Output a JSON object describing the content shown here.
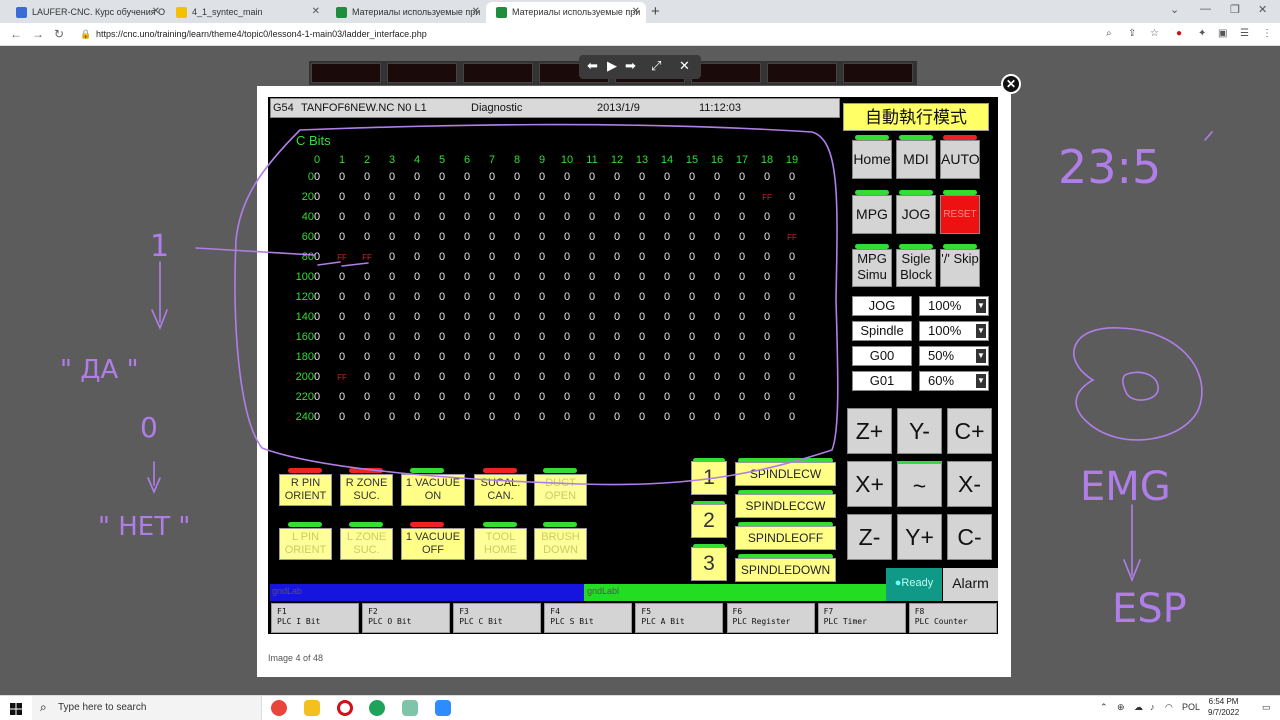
{
  "browser": {
    "tabs": [
      {
        "title": "LAUFER-CNC. Курс обучения О",
        "favicon_color": "#3b6bd6"
      },
      {
        "title": "4_1_syntec_main",
        "favicon_color": "#f2c200"
      },
      {
        "title": "Материалы используемые при",
        "favicon_color": "#1e8e3e"
      },
      {
        "title": "Материалы используемые при",
        "favicon_color": "#1e8e3e"
      }
    ],
    "url": "https://cnc.uno/training/learn/theme4/topic0/lesson4-1-main03/ladder_interface.php"
  },
  "viewer": {
    "counter": "Image 4 of 48"
  },
  "cnc": {
    "status": {
      "coord": "G54",
      "program": "TANFOF6NEW.NC N0 L1",
      "screen": "Diagnostic",
      "date": "2013/1/9",
      "time": "11:12:03"
    },
    "cbits_title": "C Bits",
    "columns": [
      "0",
      "1",
      "2",
      "3",
      "4",
      "5",
      "6",
      "7",
      "8",
      "9",
      "10",
      "11",
      "12",
      "13",
      "14",
      "15",
      "16",
      "17",
      "18",
      "19"
    ],
    "rows": [
      "0",
      "20",
      "40",
      "60",
      "80",
      "100",
      "120",
      "140",
      "160",
      "180",
      "200",
      "220",
      "240"
    ],
    "ff_cells": [
      {
        "row": "20",
        "col": 18
      },
      {
        "row": "60",
        "col": 19
      },
      {
        "row": "80",
        "col": 1
      },
      {
        "row": "80",
        "col": 2
      },
      {
        "row": "200",
        "col": 1
      }
    ],
    "mode_banner": "自動執行模式",
    "mode_buttons": [
      {
        "label": "Home",
        "led": "green"
      },
      {
        "label": "MDI",
        "led": "green"
      },
      {
        "label": "AUTO",
        "led": "red"
      },
      {
        "label": "MPG",
        "led": "green"
      },
      {
        "label": "JOG",
        "led": "green"
      },
      {
        "label": "RESET",
        "led": "green"
      },
      {
        "label": "MPG Simu",
        "led": "green"
      },
      {
        "label": "Sigle Block",
        "led": "green"
      },
      {
        "label": "'/' Skip",
        "led": "green"
      }
    ],
    "overrides": [
      {
        "label": "JOG",
        "value": "100%"
      },
      {
        "label": "Spindle",
        "value": "100%"
      },
      {
        "label": "G00",
        "value": "50%"
      },
      {
        "label": "G01",
        "value": "60%"
      }
    ],
    "jog_keys": [
      "Z+",
      "Y-",
      "C+",
      "X+",
      "~",
      "X-",
      "Z-",
      "Y+",
      "C-"
    ],
    "func_buttons_top": [
      {
        "label": "R PIN ORIENT",
        "led": "red"
      },
      {
        "label": "R ZONE SUC.",
        "led": "red"
      },
      {
        "label": "1 VACUUE ON",
        "led": "green"
      },
      {
        "label": "SUCAL. CAN.",
        "led": "red"
      },
      {
        "label": "DUCT OPEN",
        "led": "green"
      }
    ],
    "func_buttons_bottom": [
      {
        "label": "L PIN ORIENT",
        "led": "green"
      },
      {
        "label": "L ZONE SUC.",
        "led": "green"
      },
      {
        "label": "1 VACUUE OFF",
        "led": "red"
      },
      {
        "label": "TOOL HOME",
        "led": "green"
      },
      {
        "label": "BRUSH DOWN",
        "led": "green"
      }
    ],
    "num_buttons": [
      "1",
      "2",
      "3"
    ],
    "spindle_buttons": [
      "SPINDLECW",
      "SPINDLECCW",
      "SPINDLEOFF",
      "SPINDLEDOWN"
    ],
    "blue_bar_label": "gndLab",
    "green_bar_label": "gndLabl",
    "ready": "Ready",
    "alarm": "Alarm",
    "fkeys": [
      {
        "key": "F1",
        "label": "PLC I Bit"
      },
      {
        "key": "F2",
        "label": "PLC O Bit"
      },
      {
        "key": "F3",
        "label": "PLC C Bit"
      },
      {
        "key": "F4",
        "label": "PLC S Bit"
      },
      {
        "key": "F5",
        "label": "PLC A Bit"
      },
      {
        "key": "F6",
        "label": "PLC Register"
      },
      {
        "key": "F7",
        "label": "PLC Timer"
      },
      {
        "key": "F8",
        "label": "PLC Counter"
      }
    ]
  },
  "annotations": {
    "left": [
      "1",
      "\" ДА \"",
      "0",
      "\" НЕТ \""
    ],
    "right": [
      "23:5",
      "EMG",
      "ESP"
    ],
    "ink_color": "#b07ee8"
  },
  "taskbar": {
    "search_placeholder": "Type here to search",
    "language": "POL",
    "time": "6:54 PM",
    "date": "9/7/2022"
  }
}
